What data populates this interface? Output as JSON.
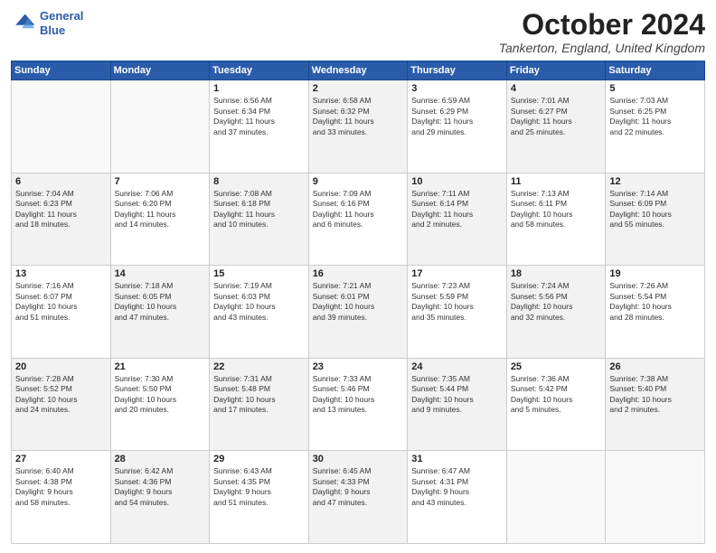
{
  "header": {
    "logo_line1": "General",
    "logo_line2": "Blue",
    "month": "October 2024",
    "location": "Tankerton, England, United Kingdom"
  },
  "days_of_week": [
    "Sunday",
    "Monday",
    "Tuesday",
    "Wednesday",
    "Thursday",
    "Friday",
    "Saturday"
  ],
  "weeks": [
    [
      {
        "day": "",
        "info": "",
        "shaded": false,
        "empty": true
      },
      {
        "day": "",
        "info": "",
        "shaded": false,
        "empty": true
      },
      {
        "day": "1",
        "info": "Sunrise: 6:56 AM\nSunset: 6:34 PM\nDaylight: 11 hours\nand 37 minutes.",
        "shaded": false
      },
      {
        "day": "2",
        "info": "Sunrise: 6:58 AM\nSunset: 6:32 PM\nDaylight: 11 hours\nand 33 minutes.",
        "shaded": true
      },
      {
        "day": "3",
        "info": "Sunrise: 6:59 AM\nSunset: 6:29 PM\nDaylight: 11 hours\nand 29 minutes.",
        "shaded": false
      },
      {
        "day": "4",
        "info": "Sunrise: 7:01 AM\nSunset: 6:27 PM\nDaylight: 11 hours\nand 25 minutes.",
        "shaded": true
      },
      {
        "day": "5",
        "info": "Sunrise: 7:03 AM\nSunset: 6:25 PM\nDaylight: 11 hours\nand 22 minutes.",
        "shaded": false
      }
    ],
    [
      {
        "day": "6",
        "info": "Sunrise: 7:04 AM\nSunset: 6:23 PM\nDaylight: 11 hours\nand 18 minutes.",
        "shaded": true
      },
      {
        "day": "7",
        "info": "Sunrise: 7:06 AM\nSunset: 6:20 PM\nDaylight: 11 hours\nand 14 minutes.",
        "shaded": false
      },
      {
        "day": "8",
        "info": "Sunrise: 7:08 AM\nSunset: 6:18 PM\nDaylight: 11 hours\nand 10 minutes.",
        "shaded": true
      },
      {
        "day": "9",
        "info": "Sunrise: 7:09 AM\nSunset: 6:16 PM\nDaylight: 11 hours\nand 6 minutes.",
        "shaded": false
      },
      {
        "day": "10",
        "info": "Sunrise: 7:11 AM\nSunset: 6:14 PM\nDaylight: 11 hours\nand 2 minutes.",
        "shaded": true
      },
      {
        "day": "11",
        "info": "Sunrise: 7:13 AM\nSunset: 6:11 PM\nDaylight: 10 hours\nand 58 minutes.",
        "shaded": false
      },
      {
        "day": "12",
        "info": "Sunrise: 7:14 AM\nSunset: 6:09 PM\nDaylight: 10 hours\nand 55 minutes.",
        "shaded": true
      }
    ],
    [
      {
        "day": "13",
        "info": "Sunrise: 7:16 AM\nSunset: 6:07 PM\nDaylight: 10 hours\nand 51 minutes.",
        "shaded": false
      },
      {
        "day": "14",
        "info": "Sunrise: 7:18 AM\nSunset: 6:05 PM\nDaylight: 10 hours\nand 47 minutes.",
        "shaded": true
      },
      {
        "day": "15",
        "info": "Sunrise: 7:19 AM\nSunset: 6:03 PM\nDaylight: 10 hours\nand 43 minutes.",
        "shaded": false
      },
      {
        "day": "16",
        "info": "Sunrise: 7:21 AM\nSunset: 6:01 PM\nDaylight: 10 hours\nand 39 minutes.",
        "shaded": true
      },
      {
        "day": "17",
        "info": "Sunrise: 7:23 AM\nSunset: 5:59 PM\nDaylight: 10 hours\nand 35 minutes.",
        "shaded": false
      },
      {
        "day": "18",
        "info": "Sunrise: 7:24 AM\nSunset: 5:56 PM\nDaylight: 10 hours\nand 32 minutes.",
        "shaded": true
      },
      {
        "day": "19",
        "info": "Sunrise: 7:26 AM\nSunset: 5:54 PM\nDaylight: 10 hours\nand 28 minutes.",
        "shaded": false
      }
    ],
    [
      {
        "day": "20",
        "info": "Sunrise: 7:28 AM\nSunset: 5:52 PM\nDaylight: 10 hours\nand 24 minutes.",
        "shaded": true
      },
      {
        "day": "21",
        "info": "Sunrise: 7:30 AM\nSunset: 5:50 PM\nDaylight: 10 hours\nand 20 minutes.",
        "shaded": false
      },
      {
        "day": "22",
        "info": "Sunrise: 7:31 AM\nSunset: 5:48 PM\nDaylight: 10 hours\nand 17 minutes.",
        "shaded": true
      },
      {
        "day": "23",
        "info": "Sunrise: 7:33 AM\nSunset: 5:46 PM\nDaylight: 10 hours\nand 13 minutes.",
        "shaded": false
      },
      {
        "day": "24",
        "info": "Sunrise: 7:35 AM\nSunset: 5:44 PM\nDaylight: 10 hours\nand 9 minutes.",
        "shaded": true
      },
      {
        "day": "25",
        "info": "Sunrise: 7:36 AM\nSunset: 5:42 PM\nDaylight: 10 hours\nand 5 minutes.",
        "shaded": false
      },
      {
        "day": "26",
        "info": "Sunrise: 7:38 AM\nSunset: 5:40 PM\nDaylight: 10 hours\nand 2 minutes.",
        "shaded": true
      }
    ],
    [
      {
        "day": "27",
        "info": "Sunrise: 6:40 AM\nSunset: 4:38 PM\nDaylight: 9 hours\nand 58 minutes.",
        "shaded": false
      },
      {
        "day": "28",
        "info": "Sunrise: 6:42 AM\nSunset: 4:36 PM\nDaylight: 9 hours\nand 54 minutes.",
        "shaded": true
      },
      {
        "day": "29",
        "info": "Sunrise: 6:43 AM\nSunset: 4:35 PM\nDaylight: 9 hours\nand 51 minutes.",
        "shaded": false
      },
      {
        "day": "30",
        "info": "Sunrise: 6:45 AM\nSunset: 4:33 PM\nDaylight: 9 hours\nand 47 minutes.",
        "shaded": true
      },
      {
        "day": "31",
        "info": "Sunrise: 6:47 AM\nSunset: 4:31 PM\nDaylight: 9 hours\nand 43 minutes.",
        "shaded": false
      },
      {
        "day": "",
        "info": "",
        "shaded": false,
        "empty": true
      },
      {
        "day": "",
        "info": "",
        "shaded": false,
        "empty": true
      }
    ]
  ]
}
